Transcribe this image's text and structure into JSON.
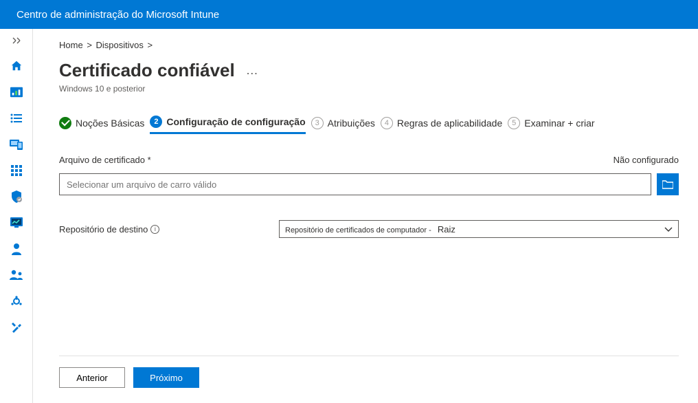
{
  "header": {
    "title": "Centro de administração do Microsoft Intune"
  },
  "breadcrumb": {
    "items": [
      "Home",
      "Dispositivos"
    ],
    "sep": ">"
  },
  "page": {
    "title": "Certificado confiável",
    "subtitle": "Windows 10 e posterior",
    "more": "…"
  },
  "wizard": {
    "steps": [
      {
        "num": "",
        "label": "Noções Básicas",
        "state": "completed"
      },
      {
        "num": "2",
        "label": "Configuração de configuração",
        "state": "active"
      },
      {
        "num": "3",
        "label": "Atribuições",
        "state": "pending"
      },
      {
        "num": "4",
        "label": "Regras de aplicabilidade",
        "state": "pending"
      },
      {
        "num": "5",
        "label": "Examinar + criar",
        "state": "last"
      }
    ]
  },
  "form": {
    "cert_label": "Arquivo de certificado *",
    "cert_status": "Não configurado",
    "cert_placeholder": "Selecionar um arquivo de carro válido",
    "dest_label": "Repositório de destino",
    "dest_value_prefix": "Repositório de certificados de computador -",
    "dest_value_suffix": "Raiz"
  },
  "footer": {
    "prev": "Anterior",
    "next": "Próximo"
  },
  "icons": {
    "home": "home-icon",
    "dashboard": "dashboard-icon",
    "list": "list-icon",
    "devices": "devices-icon",
    "apps": "apps-icon",
    "security": "shield-icon",
    "reports": "reports-icon",
    "users": "user-icon",
    "groups": "groups-icon",
    "tenant": "tenant-icon",
    "tools": "tools-icon"
  }
}
